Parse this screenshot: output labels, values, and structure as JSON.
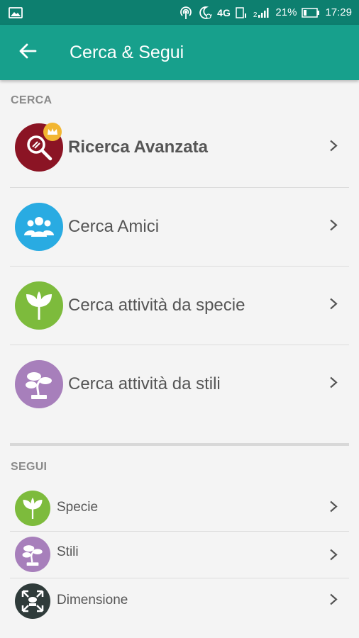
{
  "status_bar": {
    "network": "4G",
    "sim": "2",
    "battery": "21%",
    "time": "17:29"
  },
  "app_bar": {
    "title": "Cerca & Segui"
  },
  "cerca": {
    "header": "CERCA",
    "items": [
      {
        "label": "Ricerca Avanzata",
        "icon": "search-icon",
        "color": "#8b1424"
      },
      {
        "label": "Cerca Amici",
        "icon": "people-icon",
        "color": "#29abe2"
      },
      {
        "label": "Cerca attività da specie",
        "icon": "leaf-icon",
        "color": "#7dbb3c"
      },
      {
        "label": "Cerca attività da stili",
        "icon": "bonsai-icon",
        "color": "#a77fbb"
      }
    ]
  },
  "segui": {
    "header": "SEGUI",
    "items": [
      {
        "label": "Specie",
        "icon": "leaf-icon",
        "color": "#7dbb3c"
      },
      {
        "label": "Stili",
        "icon": "bonsai-icon",
        "color": "#a77fbb"
      },
      {
        "label": "Dimensione",
        "icon": "resize-icon",
        "color": "#2f3b3a"
      }
    ]
  }
}
